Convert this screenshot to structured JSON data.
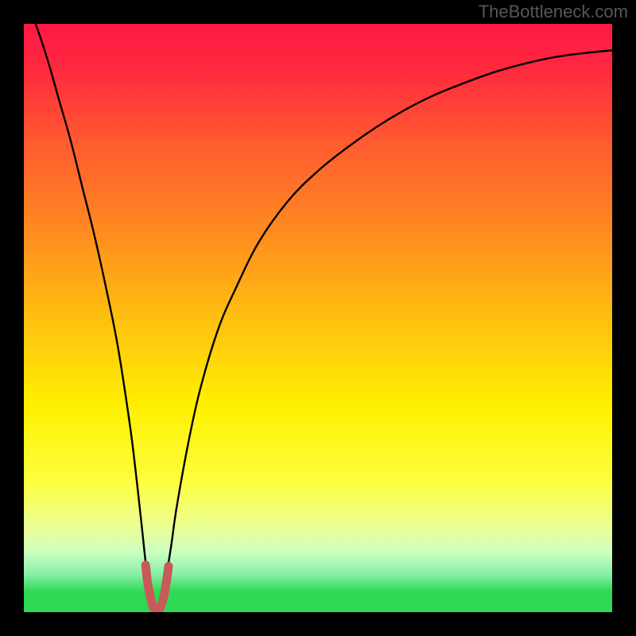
{
  "watermark": "TheBottleneck.com",
  "colors": {
    "black": "#000000",
    "curve": "#000000",
    "marker": "#c85a5a",
    "green_band": "#2fd955"
  },
  "chart_data": {
    "type": "line",
    "title": "",
    "xlabel": "",
    "ylabel": "",
    "xlim": [
      0,
      100
    ],
    "ylim": [
      0,
      100
    ],
    "gradient_stops": [
      {
        "pos": 0.0,
        "color": "#ff1845"
      },
      {
        "pos": 0.08,
        "color": "#ff2a3e"
      },
      {
        "pos": 0.2,
        "color": "#ff5a30"
      },
      {
        "pos": 0.35,
        "color": "#ff8a20"
      },
      {
        "pos": 0.5,
        "color": "#ffbf10"
      },
      {
        "pos": 0.65,
        "color": "#fff000"
      },
      {
        "pos": 0.78,
        "color": "#fcff40"
      },
      {
        "pos": 0.86,
        "color": "#eaff9a"
      },
      {
        "pos": 0.9,
        "color": "#c8ffc0"
      },
      {
        "pos": 0.935,
        "color": "#88f0a8"
      },
      {
        "pos": 0.965,
        "color": "#2fd955"
      },
      {
        "pos": 1.0,
        "color": "#2fd955"
      }
    ],
    "series": [
      {
        "name": "bottleneck-curve",
        "x": [
          0,
          2,
          4,
          6,
          8,
          10,
          12,
          14,
          16,
          18,
          19,
          20,
          21,
          22,
          22.5,
          23,
          24,
          25,
          26,
          28,
          30,
          33,
          36,
          40,
          45,
          50,
          55,
          60,
          65,
          70,
          75,
          80,
          85,
          90,
          95,
          100
        ],
        "y": [
          105,
          100,
          94,
          87,
          80,
          72,
          64,
          55,
          45,
          32,
          24,
          15,
          6,
          0.5,
          0,
          0.5,
          5,
          11,
          18,
          29,
          38,
          48,
          55,
          63,
          70,
          75,
          79,
          82.5,
          85.5,
          88,
          90,
          91.8,
          93.2,
          94.3,
          95,
          95.5
        ]
      }
    ],
    "markers": {
      "name": "valley-highlight",
      "color": "#c85a5a",
      "points": [
        {
          "x": 20.7,
          "y": 8.0
        },
        {
          "x": 21.0,
          "y": 5.3
        },
        {
          "x": 21.4,
          "y": 3.0
        },
        {
          "x": 21.8,
          "y": 1.4
        },
        {
          "x": 22.2,
          "y": 0.5
        },
        {
          "x": 22.6,
          "y": 0.3
        },
        {
          "x": 23.0,
          "y": 0.5
        },
        {
          "x": 23.4,
          "y": 1.3
        },
        {
          "x": 23.8,
          "y": 2.8
        },
        {
          "x": 24.2,
          "y": 5.0
        },
        {
          "x": 24.6,
          "y": 7.8
        }
      ]
    }
  }
}
